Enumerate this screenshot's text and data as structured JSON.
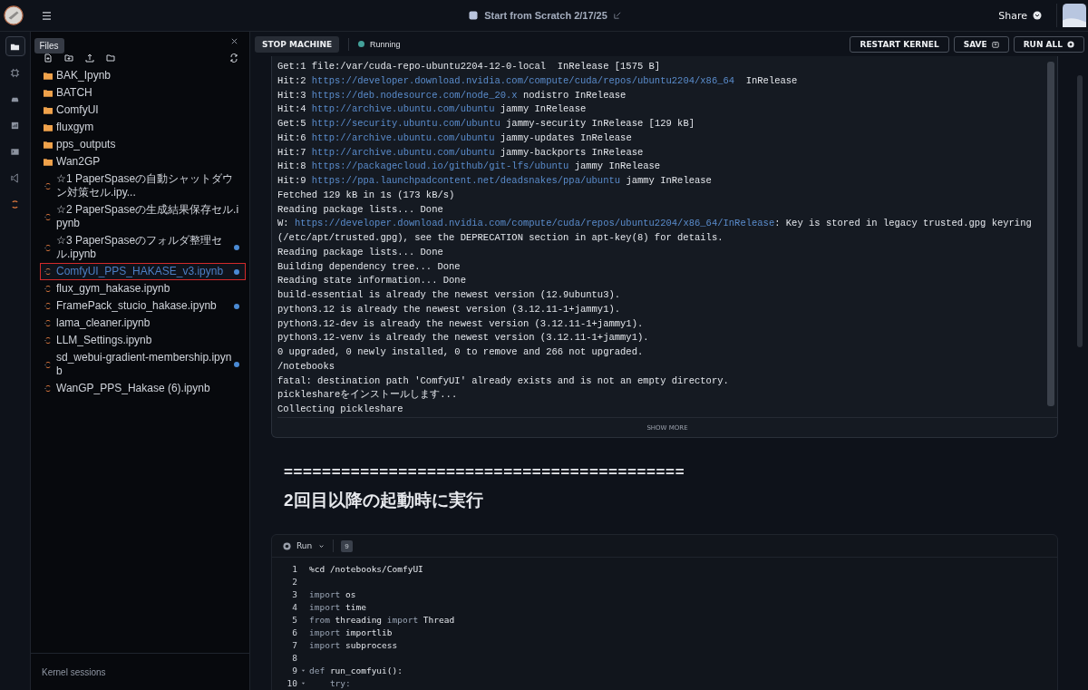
{
  "top_bar": {
    "title": "Start from Scratch 2/17/25",
    "share": "Share"
  },
  "rail": {
    "tooltip": "Files",
    "items": [
      {
        "kind": "folder",
        "selected": true
      },
      {
        "kind": "chip",
        "selected": false
      },
      {
        "kind": "stack",
        "selected": false
      },
      {
        "kind": "chart",
        "selected": false
      },
      {
        "kind": "terminal",
        "selected": false
      },
      {
        "kind": "code",
        "selected": false
      },
      {
        "kind": "notebook",
        "selected": false
      }
    ]
  },
  "file_panel": {
    "files": [
      {
        "name": "BAK_Ipynb",
        "kind": "folder",
        "selected": false,
        "modified": false
      },
      {
        "name": "BATCH",
        "kind": "folder",
        "selected": false,
        "modified": false
      },
      {
        "name": "ComfyUI",
        "kind": "folder",
        "selected": false,
        "modified": false
      },
      {
        "name": "fluxgym",
        "kind": "folder",
        "selected": false,
        "modified": false
      },
      {
        "name": "pps_outputs",
        "kind": "folder",
        "selected": false,
        "modified": false
      },
      {
        "name": "Wan2GP",
        "kind": "folder",
        "selected": false,
        "modified": false
      },
      {
        "name": "☆1 PaperSpaseの自動シャットダウン対策セル.ipy...",
        "kind": "notebook",
        "selected": false,
        "modified": false
      },
      {
        "name": "☆2 PaperSpaseの生成結果保存セル.ipynb",
        "kind": "notebook",
        "selected": false,
        "modified": false
      },
      {
        "name": "☆3 PaperSpaseのフォルダ整理セル.ipynb",
        "kind": "notebook",
        "selected": false,
        "modified": true
      },
      {
        "name": "ComfyUI_PPS_HAKASE_v3.ipynb",
        "kind": "notebook",
        "selected": true,
        "modified": true
      },
      {
        "name": "flux_gym_hakase.ipynb",
        "kind": "notebook",
        "selected": false,
        "modified": false
      },
      {
        "name": "FramePack_stucio_hakase.ipynb",
        "kind": "notebook",
        "selected": false,
        "modified": true
      },
      {
        "name": "lama_cleaner.ipynb",
        "kind": "notebook",
        "selected": false,
        "modified": false
      },
      {
        "name": "LLM_Settings.ipynb",
        "kind": "notebook",
        "selected": false,
        "modified": false
      },
      {
        "name": "sd_webui-gradient-membership.ipynb",
        "kind": "notebook",
        "selected": false,
        "modified": true
      },
      {
        "name": "WanGP_PPS_Hakase (6).ipynb",
        "kind": "notebook",
        "selected": false,
        "modified": false
      }
    ],
    "footer": "Kernel sessions"
  },
  "machine_bar": {
    "stop": "STOP MACHINE",
    "status": "Running",
    "buttons": [
      {
        "label": "RESTART KERNEL",
        "kind": "plain"
      },
      {
        "label": "SAVE",
        "kind": "save"
      },
      {
        "label": "RUN ALL",
        "kind": "run"
      }
    ]
  },
  "output_cell": {
    "lines": [
      [
        {
          "kind": "text",
          "text": "Get:1 file:/var/cuda-repo-ubuntu2204-12-0-local  InRelease [1575 B]"
        }
      ],
      [
        {
          "kind": "text",
          "text": "Hit:2 "
        },
        {
          "kind": "link",
          "text": "https://developer.download.nvidia.com/compute/cuda/repos/ubuntu2204/x86_64"
        },
        {
          "kind": "text",
          "text": "  InRelease"
        }
      ],
      [
        {
          "kind": "text",
          "text": "Hit:3 "
        },
        {
          "kind": "link",
          "text": "https://deb.nodesource.com/node_20.x"
        },
        {
          "kind": "text",
          "text": " nodistro InRelease"
        }
      ],
      [
        {
          "kind": "text",
          "text": "Hit:4 "
        },
        {
          "kind": "link",
          "text": "http://archive.ubuntu.com/ubuntu"
        },
        {
          "kind": "text",
          "text": " jammy InRelease"
        }
      ],
      [
        {
          "kind": "text",
          "text": "Get:5 "
        },
        {
          "kind": "link",
          "text": "http://security.ubuntu.com/ubuntu"
        },
        {
          "kind": "text",
          "text": " jammy-security InRelease [129 kB]"
        }
      ],
      [
        {
          "kind": "text",
          "text": "Hit:6 "
        },
        {
          "kind": "link",
          "text": "http://archive.ubuntu.com/ubuntu"
        },
        {
          "kind": "text",
          "text": " jammy-updates InRelease"
        }
      ],
      [
        {
          "kind": "text",
          "text": "Hit:7 "
        },
        {
          "kind": "link",
          "text": "http://archive.ubuntu.com/ubuntu"
        },
        {
          "kind": "text",
          "text": " jammy-backports InRelease"
        }
      ],
      [
        {
          "kind": "text",
          "text": "Hit:8 "
        },
        {
          "kind": "link",
          "text": "https://packagecloud.io/github/git-lfs/ubuntu"
        },
        {
          "kind": "text",
          "text": " jammy InRelease"
        }
      ],
      [
        {
          "kind": "text",
          "text": "Hit:9 "
        },
        {
          "kind": "link",
          "text": "https://ppa.launchpadcontent.net/deadsnakes/ppa/ubuntu"
        },
        {
          "kind": "text",
          "text": " jammy InRelease"
        }
      ],
      [
        {
          "kind": "text",
          "text": "Fetched 129 kB in 1s (173 kB/s)"
        }
      ],
      [
        {
          "kind": "text",
          "text": "Reading package lists... Done"
        }
      ],
      [
        {
          "kind": "text",
          "text": "W: "
        },
        {
          "kind": "link",
          "text": "https://developer.download.nvidia.com/compute/cuda/repos/ubuntu2204/x86_64/InRelease"
        },
        {
          "kind": "text",
          "text": ": Key is stored in legacy trusted.gpg keyring"
        }
      ],
      [
        {
          "kind": "text",
          "text": "(/etc/apt/trusted.gpg), see the DEPRECATION section in apt-key(8) for details."
        }
      ],
      [
        {
          "kind": "text",
          "text": "Reading package lists... Done"
        }
      ],
      [
        {
          "kind": "text",
          "text": "Building dependency tree... Done"
        }
      ],
      [
        {
          "kind": "text",
          "text": "Reading state information... Done"
        }
      ],
      [
        {
          "kind": "text",
          "text": "build-essential is already the newest version (12.9ubuntu3)."
        }
      ],
      [
        {
          "kind": "text",
          "text": "python3.12 is already the newest version (3.12.11-1+jammy1)."
        }
      ],
      [
        {
          "kind": "text",
          "text": "python3.12-dev is already the newest version (3.12.11-1+jammy1)."
        }
      ],
      [
        {
          "kind": "text",
          "text": "python3.12-venv is already the newest version (3.12.11-1+jammy1)."
        }
      ],
      [
        {
          "kind": "text",
          "text": "0 upgraded, 0 newly installed, 0 to remove and 266 not upgraded."
        }
      ],
      [
        {
          "kind": "text",
          "text": "/notebooks"
        }
      ],
      [
        {
          "kind": "text",
          "text": "fatal: destination path 'ComfyUI' already exists and is not an empty directory."
        }
      ],
      [
        {
          "kind": "text",
          "text": "pickleshareをインストールします..."
        }
      ],
      [
        {
          "kind": "text",
          "text": "Collecting pickleshare"
        }
      ]
    ],
    "show_more": "SHOW MORE"
  },
  "markdown": {
    "rule": "==========================================",
    "heading": "2回目以降の起動時に実行"
  },
  "code_cell": {
    "run": "Run",
    "exec_count": "9",
    "lines": [
      {
        "number": "1",
        "foldable": false,
        "tokens": [
          {
            "kind": "plain",
            "text": "%cd /notebooks/ComfyUI"
          }
        ]
      },
      {
        "number": "2",
        "foldable": false
      },
      {
        "number": "3",
        "foldable": false,
        "tokens": [
          {
            "kind": "keyword",
            "text": "import"
          },
          {
            "kind": "plain",
            "text": " os"
          }
        ]
      },
      {
        "number": "4",
        "foldable": false,
        "tokens": [
          {
            "kind": "keyword",
            "text": "import"
          },
          {
            "kind": "plain",
            "text": " time"
          }
        ]
      },
      {
        "number": "5",
        "foldable": false,
        "tokens": [
          {
            "kind": "keyword",
            "text": "from"
          },
          {
            "kind": "plain",
            "text": " threading "
          },
          {
            "kind": "keyword",
            "text": "import"
          },
          {
            "kind": "plain",
            "text": " Thread"
          }
        ]
      },
      {
        "number": "6",
        "foldable": false,
        "tokens": [
          {
            "kind": "keyword",
            "text": "import"
          },
          {
            "kind": "plain",
            "text": " importlib"
          }
        ]
      },
      {
        "number": "7",
        "foldable": false,
        "tokens": [
          {
            "kind": "keyword",
            "text": "import"
          },
          {
            "kind": "plain",
            "text": " subprocess"
          }
        ]
      },
      {
        "number": "8",
        "foldable": false
      },
      {
        "number": "9",
        "foldable": true,
        "tokens": [
          {
            "kind": "keyword",
            "text": "def"
          },
          {
            "kind": "plain",
            "text": " run_comfyui():"
          }
        ]
      },
      {
        "number": "10",
        "foldable": true,
        "tokens": [
          {
            "kind": "keyword",
            "text": "    try:"
          }
        ]
      }
    ]
  }
}
